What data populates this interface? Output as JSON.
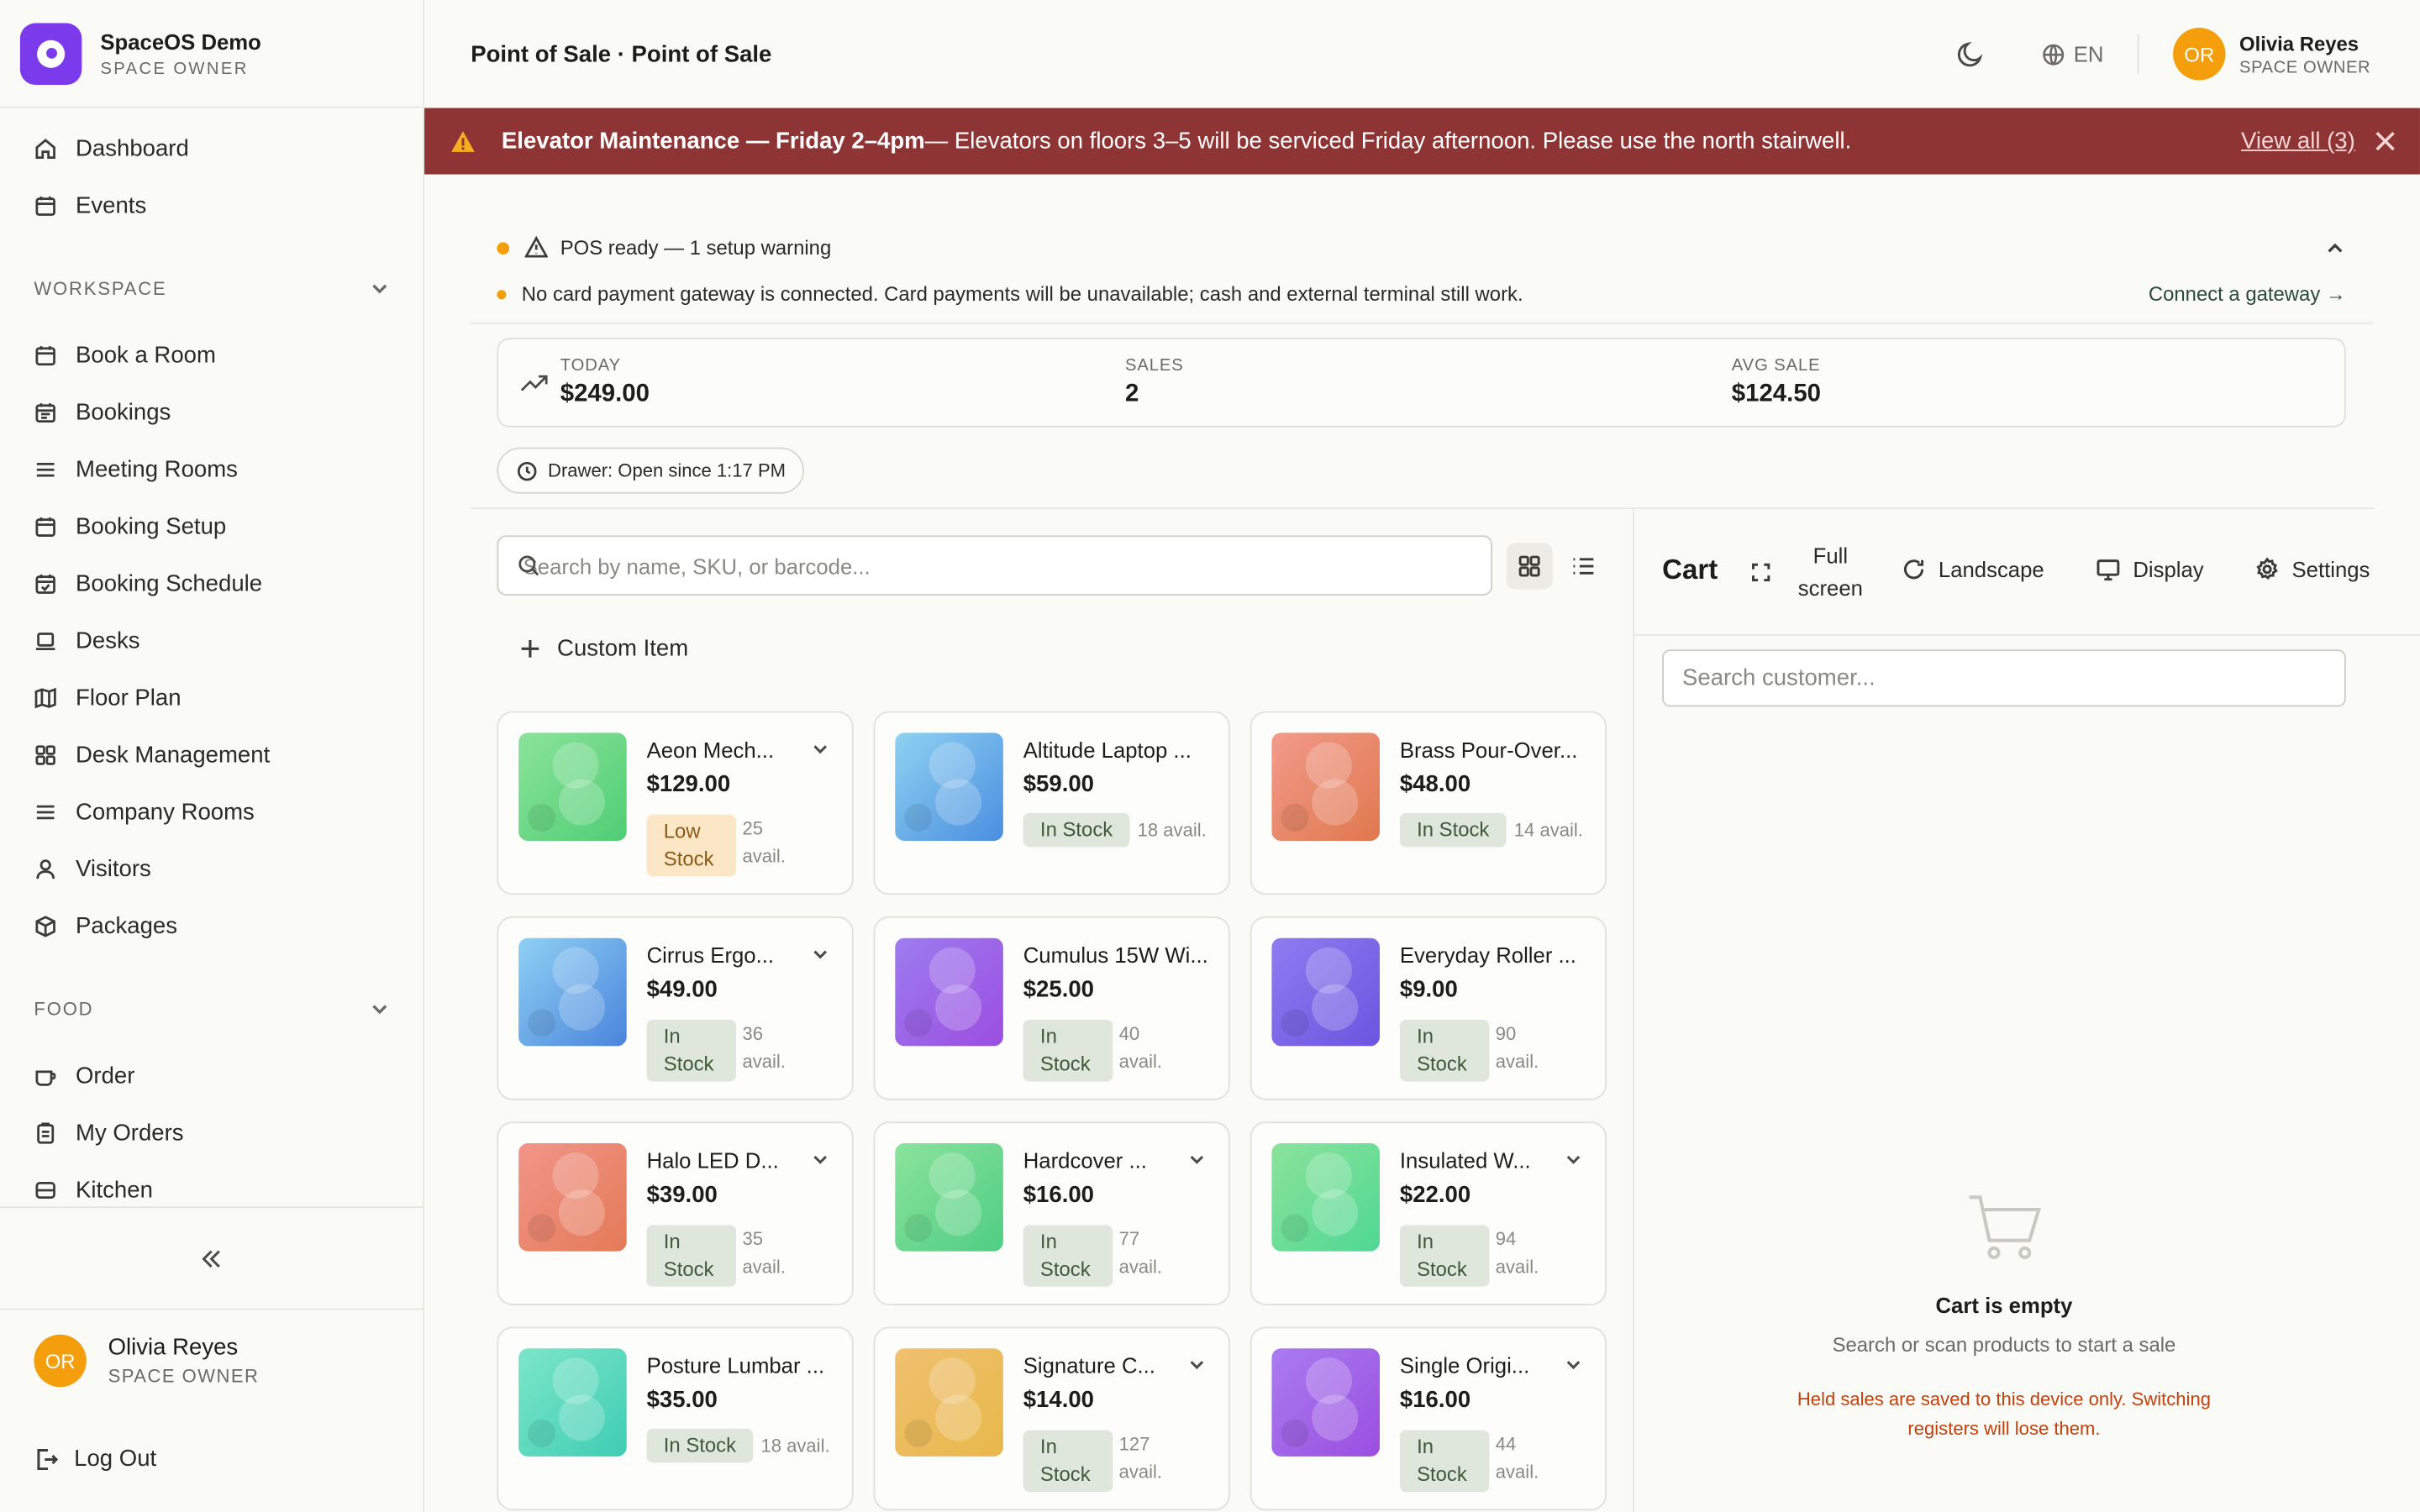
{
  "brand": {
    "name": "SpaceOS Demo",
    "role": "SPACE OWNER"
  },
  "nav": {
    "top": [
      {
        "label": "Dashboard",
        "icon": "home-icon"
      },
      {
        "label": "Events",
        "icon": "calendar-icon"
      }
    ],
    "workspace_title": "WORKSPACE",
    "workspace": [
      {
        "label": "Book a Room",
        "icon": "calendar-icon"
      },
      {
        "label": "Bookings",
        "icon": "calendar-list-icon"
      },
      {
        "label": "Meeting Rooms",
        "icon": "menu-icon"
      },
      {
        "label": "Booking Setup",
        "icon": "calendar-icon"
      },
      {
        "label": "Booking Schedule",
        "icon": "calendar-check-icon"
      },
      {
        "label": "Desks",
        "icon": "laptop-icon"
      },
      {
        "label": "Floor Plan",
        "icon": "map-icon"
      },
      {
        "label": "Desk Management",
        "icon": "grid-icon"
      },
      {
        "label": "Company Rooms",
        "icon": "menu-icon"
      },
      {
        "label": "Visitors",
        "icon": "user-icon"
      },
      {
        "label": "Packages",
        "icon": "package-icon"
      }
    ],
    "food_title": "FOOD",
    "food": [
      {
        "label": "Order",
        "icon": "cup-icon"
      },
      {
        "label": "My Orders",
        "icon": "clipboard-icon"
      },
      {
        "label": "Kitchen",
        "icon": "kitchen-icon"
      }
    ]
  },
  "user": {
    "initials": "OR",
    "name": "Olivia Reyes",
    "role": "SPACE OWNER",
    "top_role": "SPACE OWNER"
  },
  "logout_label": "Log Out",
  "header": {
    "breadcrumb": "Point of Sale · Point of Sale",
    "lang": "EN"
  },
  "banner": {
    "title": "Elevator Maintenance — Friday 2–4pm",
    "message": " — Elevators on floors 3–5 will be serviced Friday afternoon. Please use the north stairwell.",
    "view_all": "View all (3)",
    "color": "#8f3434"
  },
  "setup": {
    "status": "POS ready — 1 setup warning",
    "warning": "No card payment gateway is connected. Card payments will be unavailable; cash and external terminal still work.",
    "action": "Connect a gateway →"
  },
  "stats": {
    "today_label": "TODAY",
    "today_value": "$249.00",
    "sales_label": "SALES",
    "sales_value": "2",
    "avg_label": "AVG SALE",
    "avg_value": "$124.50"
  },
  "drawer": "Drawer: Open since 1:17 PM",
  "search": {
    "placeholder": "Search by name, SKU, or barcode..."
  },
  "custom_item": "Custom Item",
  "products": [
    {
      "name": "Aeon Mech...",
      "price": "$129.00",
      "status": "Low Stock",
      "avail": "25 avail.",
      "chevron": true,
      "color1": "#8be39a",
      "color2": "#4fce74"
    },
    {
      "name": "Altitude Laptop ...",
      "price": "$59.00",
      "status": "In Stock",
      "avail": "18 avail.",
      "chevron": false,
      "color1": "#8fd2f2",
      "color2": "#4a8ee0"
    },
    {
      "name": "Brass Pour-Over...",
      "price": "$48.00",
      "status": "In Stock",
      "avail": "14 avail.",
      "chevron": false,
      "color1": "#f29a8a",
      "color2": "#e0784e"
    },
    {
      "name": "Cirrus Ergo...",
      "price": "$49.00",
      "status": "In Stock",
      "avail": "36 avail.",
      "chevron": true,
      "color1": "#8fd0f4",
      "color2": "#4a84dc"
    },
    {
      "name": "Cumulus 15W Wi...",
      "price": "$25.00",
      "status": "In Stock",
      "avail": "40 avail.",
      "chevron": false,
      "color1": "#9d7cf0",
      "color2": "#9b4ee0"
    },
    {
      "name": "Everyday Roller ...",
      "price": "$9.00",
      "status": "In Stock",
      "avail": "90 avail.",
      "chevron": false,
      "color1": "#8f7cf0",
      "color2": "#6b54e0"
    },
    {
      "name": "Halo LED D...",
      "price": "$39.00",
      "status": "In Stock",
      "avail": "35 avail.",
      "chevron": true,
      "color1": "#f2958a",
      "color2": "#e47a56"
    },
    {
      "name": "Hardcover ...",
      "price": "$16.00",
      "status": "In Stock",
      "avail": "77 avail.",
      "chevron": true,
      "color1": "#8be39a",
      "color2": "#4fce84"
    },
    {
      "name": "Insulated W...",
      "price": "$22.00",
      "status": "In Stock",
      "avail": "94 avail.",
      "chevron": true,
      "color1": "#8be39a",
      "color2": "#4fd894"
    },
    {
      "name": "Posture Lumbar ...",
      "price": "$35.00",
      "status": "In Stock",
      "avail": "18 avail.",
      "chevron": false,
      "color1": "#7ce6c8",
      "color2": "#3fcdb4"
    },
    {
      "name": "Signature C...",
      "price": "$14.00",
      "status": "In Stock",
      "avail": "127 avail.",
      "chevron": true,
      "color1": "#f0c070",
      "color2": "#e8b84a"
    },
    {
      "name": "Single Origi...",
      "price": "$16.00",
      "status": "In Stock",
      "avail": "44 avail.",
      "chevron": true,
      "color1": "#a97cf0",
      "color2": "#9a4ee0"
    }
  ],
  "cart": {
    "title": "Cart",
    "fullscreen": "Full screen",
    "fullscreen_line1": "Full",
    "fullscreen_line2": "screen",
    "landscape": "Landscape",
    "display": "Display",
    "settings": "Settings",
    "customer_placeholder": "Search customer...",
    "empty_title": "Cart is empty",
    "empty_sub": "Search or scan products to start a sale",
    "held_note_line1": "Held sales are saved to this device only. Switching",
    "held_note_line2": "registers will lose them."
  },
  "colors": {
    "accent": "#7c3aed",
    "warning": "#f59e0b",
    "in_stock_bg": "#dfe6dc",
    "low_stock_bg": "#fbe6c6"
  }
}
